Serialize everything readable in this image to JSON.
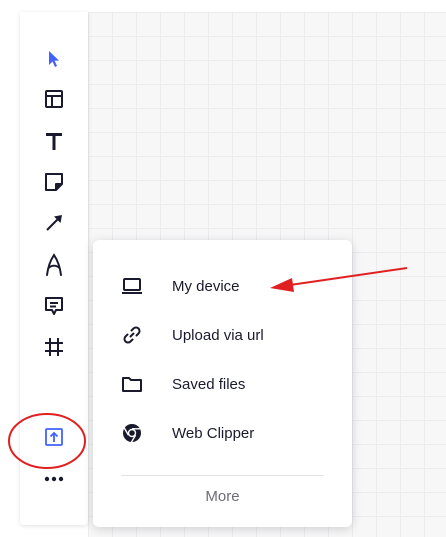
{
  "menu": {
    "items": [
      {
        "label": "My device",
        "icon": "laptop-icon"
      },
      {
        "label": "Upload via url",
        "icon": "link-icon"
      },
      {
        "label": "Saved files",
        "icon": "folder-icon"
      },
      {
        "label": "Web Clipper",
        "icon": "chrome-icon"
      }
    ],
    "more_label": "More"
  },
  "toolbar": {
    "tools": [
      "select-icon",
      "templates-icon",
      "text-icon",
      "sticky-note-icon",
      "connection-line-icon",
      "pen-icon",
      "comment-icon",
      "frame-icon",
      "upload-icon",
      "more-tools-icon"
    ],
    "active": "upload-icon"
  },
  "colors": {
    "accent": "#4262ff",
    "annotation": "#e02020",
    "icon": "#1a1a2e"
  }
}
